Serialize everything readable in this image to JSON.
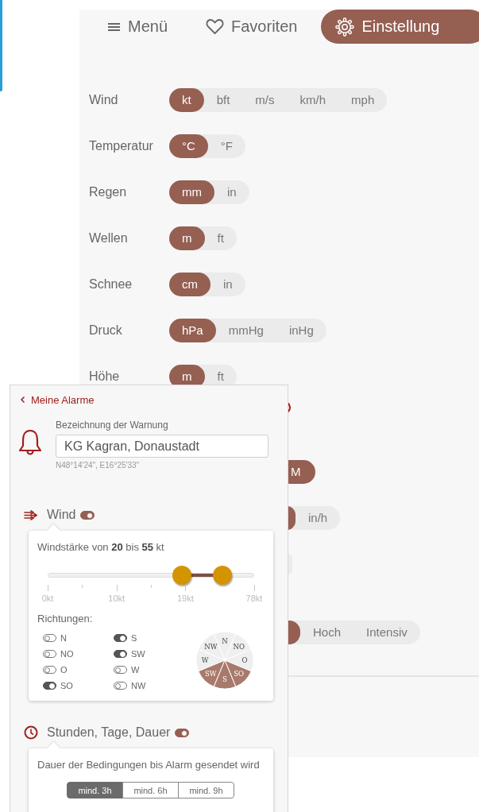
{
  "tabs": [
    {
      "label": "Menü",
      "selected": false
    },
    {
      "label": "Favoriten",
      "selected": false
    },
    {
      "label": "Einstellung",
      "selected": true
    }
  ],
  "settings": [
    {
      "label": "Wind",
      "options": [
        {
          "label": "kt",
          "selected": true
        },
        {
          "label": "bft",
          "selected": false
        },
        {
          "label": "m/s",
          "selected": false
        },
        {
          "label": "km/h",
          "selected": false
        },
        {
          "label": "mph",
          "selected": false
        }
      ]
    },
    {
      "label": "Temperatur",
      "options": [
        {
          "label": "°C",
          "selected": true
        },
        {
          "label": "°F",
          "selected": false
        }
      ]
    },
    {
      "label": "Regen",
      "options": [
        {
          "label": "mm",
          "selected": true
        },
        {
          "label": "in",
          "selected": false
        }
      ]
    },
    {
      "label": "Wellen",
      "options": [
        {
          "label": "m",
          "selected": true
        },
        {
          "label": "ft",
          "selected": false
        }
      ]
    },
    {
      "label": "Schnee",
      "options": [
        {
          "label": "cm",
          "selected": true
        },
        {
          "label": "in",
          "selected": false
        }
      ]
    },
    {
      "label": "Druck",
      "options": [
        {
          "label": "hPa",
          "selected": true
        },
        {
          "label": "mmHg",
          "selected": false
        },
        {
          "label": "inHg",
          "selected": false
        }
      ]
    },
    {
      "label": "Höhe",
      "options": [
        {
          "label": "m",
          "selected": true
        },
        {
          "label": "ft",
          "selected": false
        }
      ]
    }
  ],
  "partial_settings": [
    {
      "kind": "marker"
    },
    {
      "kind": "units",
      "options": [
        {
          "label": "M",
          "selected": true
        }
      ]
    },
    {
      "kind": "units",
      "options": [
        {
          "selected": true
        },
        {
          "label": "in/h",
          "selected": false
        }
      ]
    },
    {
      "kind": "units",
      "options": [
        {
          "selected": false
        }
      ]
    },
    {
      "kind": "units",
      "options": [
        {
          "selected": true
        },
        {
          "label": "Hoch",
          "selected": false
        },
        {
          "label": "Intensiv",
          "selected": false
        }
      ]
    }
  ],
  "alarm": {
    "back_link": "Meine Alarme",
    "name_label": "Bezeichnung der Warnung",
    "name_value": "KG Kagran, Donaustadt",
    "coordinates": "N48°14'24\", E16°25'33\"",
    "sections": [
      {
        "kind": "wind",
        "title": "Wind",
        "on": true,
        "range_text": "Windstärke von **20** bis **55** kt",
        "slider": {
          "thumbs": [
            {
              "level": 0.65
            },
            {
              "level": 0.85
            }
          ],
          "tick_labels": [
            "0kt",
            "10kt",
            "19kt",
            "78kt"
          ]
        },
        "directions_label": "Richtungen:",
        "directions": [
          {
            "label": "N",
            "on": false
          },
          {
            "label": "NO",
            "on": false
          },
          {
            "label": "O",
            "on": false
          },
          {
            "label": "SO",
            "on": true
          },
          {
            "label": "S",
            "on": true
          },
          {
            "label": "SW",
            "on": true
          },
          {
            "label": "W",
            "on": false
          },
          {
            "label": "NW",
            "on": false
          }
        ],
        "compass": [
          {
            "label": "N",
            "selected": false
          },
          {
            "label": "NW",
            "selected": false
          },
          {
            "label": "NO",
            "selected": false
          },
          {
            "label": "W",
            "selected": false
          },
          {
            "label": "O",
            "selected": false
          },
          {
            "label": "SW",
            "selected": true
          },
          {
            "label": "SO",
            "selected": true
          },
          {
            "label": "S",
            "selected": true
          }
        ]
      },
      {
        "kind": "duration",
        "title": "Stunden, Tage, Dauer",
        "on": true,
        "description": "Dauer der Bedingungen bis Alarm gesendet wird",
        "choices": [
          {
            "label": "mind. 3h",
            "selected": true
          },
          {
            "label": "mind. 6h",
            "selected": false
          },
          {
            "label": "mind. 9h",
            "selected": false
          }
        ]
      }
    ]
  }
}
